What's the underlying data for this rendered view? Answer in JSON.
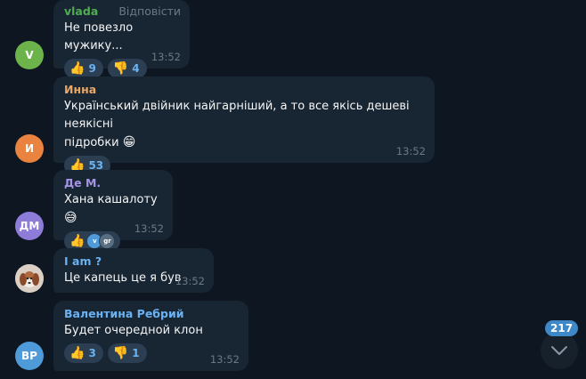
{
  "messages": [
    {
      "author": "vlada",
      "author_color": "#4fae4e",
      "reply_label": "Відповісти",
      "text": "Не повезло мужику...",
      "time": "13:52",
      "avatar_initials": "V",
      "avatar_color": "#6cb34b",
      "reactions": [
        {
          "emoji": "👍",
          "count": "9"
        },
        {
          "emoji": "👎",
          "count": "4"
        }
      ]
    },
    {
      "author": "Инна",
      "author_color": "#e9a867",
      "text_line1": "Український двійник найгарніший, а то все якісь дешеві неякісні",
      "text_line2": "підробки",
      "text_emoji": "😁",
      "time": "13:52",
      "avatar_initials": "И",
      "avatar_color": "#e9833f",
      "reactions": [
        {
          "emoji": "👍",
          "count": "53"
        }
      ]
    },
    {
      "author": "Де М.",
      "author_color": "#a695e7",
      "text": "Хана кашалоту",
      "text_emoji": "😅",
      "time": "13:52",
      "avatar_initials": "ДМ",
      "avatar_color": "#8e7cd9",
      "reactions": [
        {
          "emoji": "👍",
          "recent_avatars": [
            {
              "initial": "v",
              "color": "#4f9ad9"
            },
            {
              "initial": "gr",
              "color": "#5a6e83"
            }
          ]
        }
      ]
    },
    {
      "author": "I am ?",
      "author_color": "#6ab2f2",
      "text": "Це капець це я був",
      "time": "13:52",
      "avatar_initials": "",
      "avatar_color": "#c9b7a3"
    },
    {
      "author": "Валентина Ребрий",
      "author_color": "#6ab2f2",
      "text": "Будет очередной клон",
      "time": "13:52",
      "avatar_initials": "ВР",
      "avatar_color": "#4f9ad9",
      "reactions": [
        {
          "emoji": "👍",
          "count": "3"
        },
        {
          "emoji": "👎",
          "count": "1"
        }
      ]
    }
  ],
  "scroll_down": {
    "unread_count": "217",
    "icon": "chevron-down-icon"
  }
}
